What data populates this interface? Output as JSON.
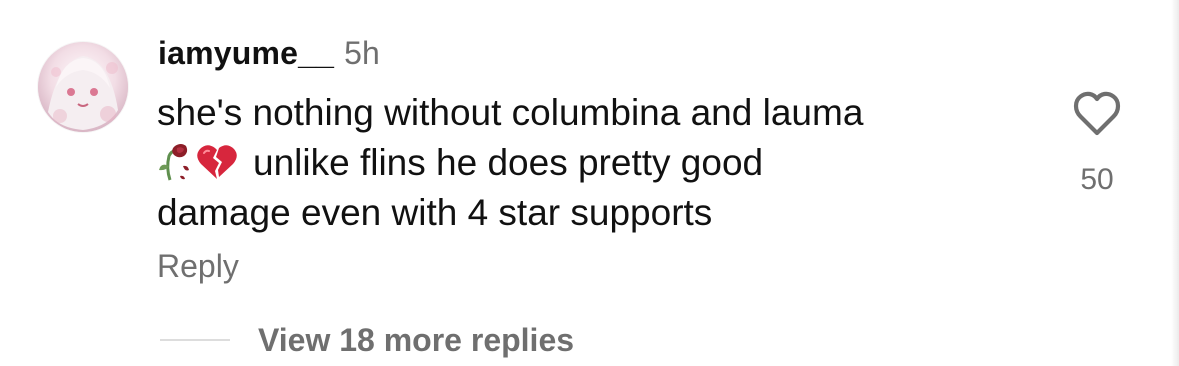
{
  "comment": {
    "username": "iamyume__",
    "time": "5h",
    "text_lines": [
      "she's nothing without columbina and lauma",
      "unlike flins he does pretty good",
      "damage even with 4 star supports"
    ],
    "emojis": [
      "wilted-rose-icon",
      "broken-heart-icon"
    ],
    "reply_label": "Reply",
    "view_replies_label": "View 18 more replies",
    "like_count": "50"
  },
  "colors": {
    "primary_text": "#111111",
    "secondary_text": "#6f6f6f",
    "broken_heart": "#d7263d",
    "divider": "#dddddd"
  }
}
